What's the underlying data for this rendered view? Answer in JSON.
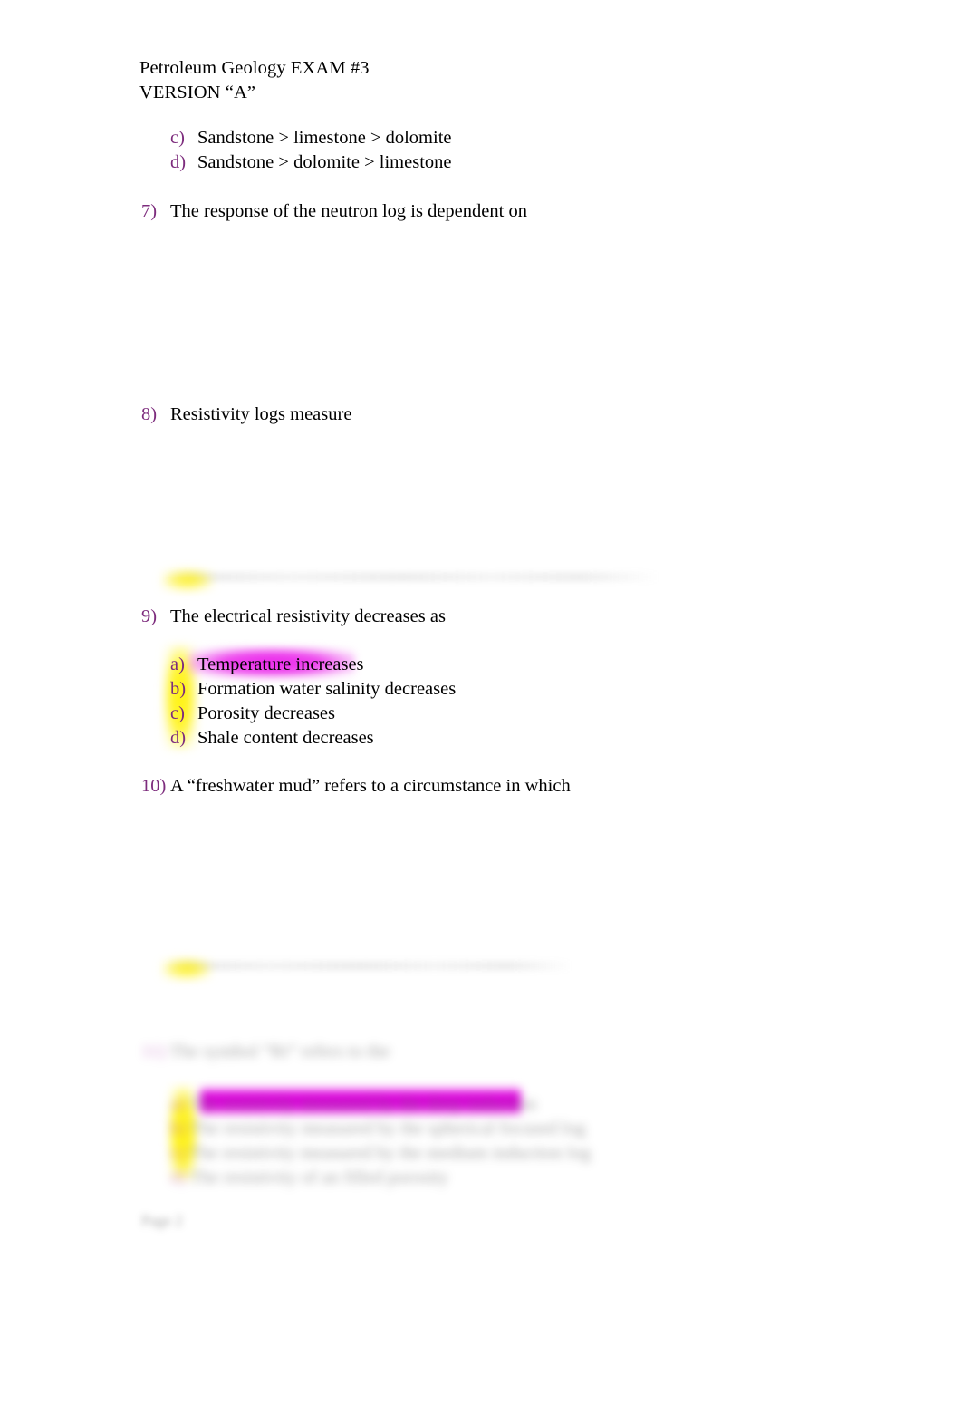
{
  "document": {
    "header": {
      "line1": "Petroleum Geology EXAM #3",
      "line2": "VERSION “A”"
    },
    "footer": {
      "page_label": "Page 2"
    }
  },
  "carryover_options": {
    "items": [
      {
        "marker": "c)",
        "text": "Sandstone > limestone > dolomite"
      },
      {
        "marker": "d)",
        "text": "Sandstone > dolomite > limestone"
      }
    ]
  },
  "questions": [
    {
      "number": "7)",
      "stem": "The response of the neutron log is dependent on",
      "options": []
    },
    {
      "number": "8)",
      "stem": "Resistivity logs measure",
      "options": []
    },
    {
      "number": "9)",
      "stem": "The electrical resistivity decreases as",
      "options": [
        {
          "marker": "a)",
          "text": "Temperature increases",
          "highlight": "magenta"
        },
        {
          "marker": "b)",
          "text": "Formation water salinity decreases",
          "highlight": "none"
        },
        {
          "marker": "c)",
          "text": "Porosity decreases",
          "highlight": "none"
        },
        {
          "marker": "d)",
          "text": "Shale content decreases",
          "highlight": "none"
        }
      ]
    },
    {
      "number": "10)",
      "stem": "A “freshwater mud” refers to a circumstance in which",
      "options": []
    },
    {
      "number": "11)",
      "stem": "The symbol “Rt” refers to the",
      "legible": false,
      "options": [
        {
          "marker": "a)",
          "text": "The resistivity measured by the deep induction",
          "highlight": "magenta-bar",
          "legible": false
        },
        {
          "marker": "b)",
          "text": "The resistivity measured by the spherical focused log",
          "highlight": "none",
          "legible": false
        },
        {
          "marker": "c)",
          "text": "The resistivity measured by the medium induction log",
          "highlight": "none",
          "legible": false
        },
        {
          "marker": "d)",
          "text": "The resistivity of an filled porosity",
          "highlight": "none",
          "legible": false
        }
      ]
    }
  ],
  "colors": {
    "marker_purple": "#7D2C7D",
    "highlight_magenta": "#D600D6",
    "highlight_yellow": "#FFF200",
    "text_black": "#000000",
    "page_background": "#FFFFFF"
  }
}
